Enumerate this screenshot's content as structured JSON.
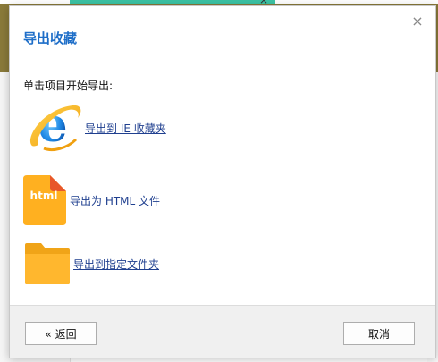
{
  "dialog": {
    "title": "导出收藏",
    "instruction": "单击项目开始导出:",
    "options": [
      {
        "label": "导出到 IE 收藏夹",
        "icon": "internet-explorer-icon"
      },
      {
        "label": "导出为 HTML 文件",
        "icon": "html-file-icon",
        "icon_text": "html"
      },
      {
        "label": "导出到指定文件夹",
        "icon": "folder-icon"
      }
    ],
    "back_label": "« 返回",
    "cancel_label": "取消",
    "close_glyph": "×"
  },
  "background": {
    "tab_close_glyph": "×"
  },
  "colors": {
    "title": "#1e6ec8",
    "link": "#1f3f8f",
    "html_icon": "#ffb020",
    "html_icon_corner": "#e8572a",
    "folder": "#ffb72e",
    "tab_accent": "#3cc3a4",
    "header_bg": "#8a7a3a"
  }
}
